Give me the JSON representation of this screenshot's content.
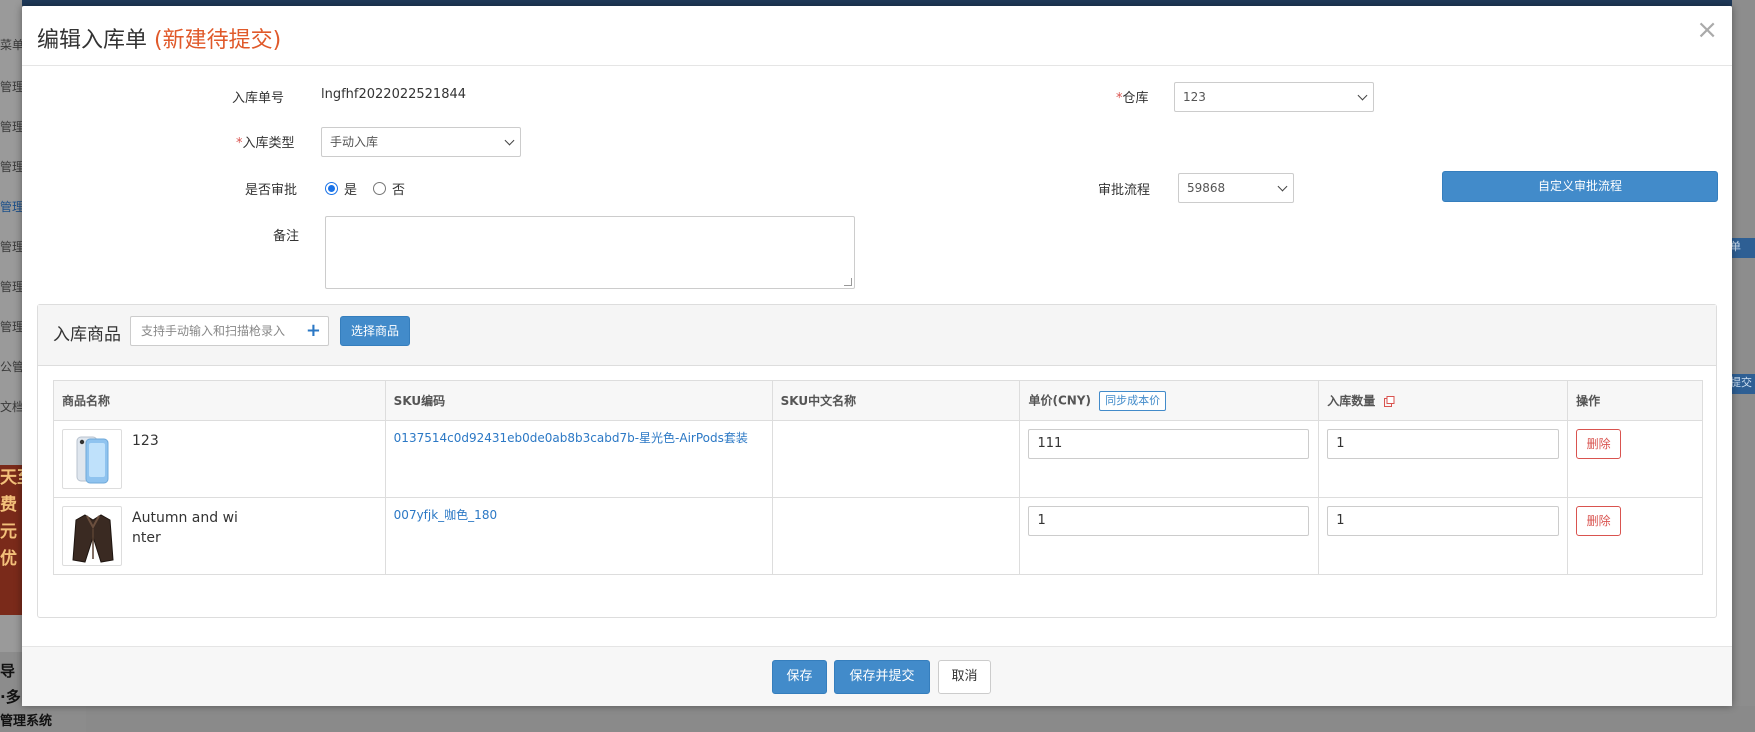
{
  "background": {
    "sidebar_items": [
      "菜单",
      "管理",
      "管理",
      "管理",
      "管理",
      "管理",
      "管理",
      "管理",
      "公管",
      "文档"
    ],
    "ad_lines": [
      "天至",
      "费",
      "元",
      "优"
    ],
    "bottom_left_lines": [
      "导",
      "·多",
      "管理系统"
    ],
    "right_tabs": [
      "单",
      "提交"
    ]
  },
  "modal": {
    "title": "编辑入库单",
    "status": "(新建待提交)",
    "close": "×"
  },
  "form": {
    "order_no_label": "入库单号",
    "order_no_value": "lngfhf2022022521844",
    "warehouse_label": "仓库",
    "warehouse_value": "123",
    "type_label": "入库类型",
    "type_value": "手动入库",
    "approval_label": "是否审批",
    "approval_yes": "是",
    "approval_no": "否",
    "approval_selected": "是",
    "flow_label": "审批流程",
    "flow_value": "59868",
    "custom_flow_button": "自定义审批流程",
    "remark_label": "备注",
    "remark_value": "",
    "required_mark": "*"
  },
  "goods": {
    "title": "入库商品",
    "scan_placeholder": "支持手动输入和扫描枪录入",
    "select_button": "选择商品",
    "columns": [
      "商品名称",
      "SKU编码",
      "SKU中文名称",
      "单价(CNY)",
      "入库数量",
      "操作"
    ],
    "sync_cost_button": "同步成本价",
    "rows": [
      {
        "name": "123",
        "sku": "0137514c0d92431eb0de0ab8b3cabd7b-星光色-AirPods套装",
        "sku_cn": "",
        "price": "111",
        "qty": "1",
        "delete": "删除",
        "thumb_icon": "phone-product-icon"
      },
      {
        "name": "Autumn and winter",
        "sku": "007yfjk_咖色_180",
        "sku_cn": "",
        "price": "1",
        "qty": "1",
        "delete": "删除",
        "thumb_icon": "jacket-product-icon"
      }
    ]
  },
  "footer": {
    "save": "保存",
    "save_submit": "保存并提交",
    "cancel": "取消"
  },
  "colors": {
    "primary": "#428bca",
    "danger": "#d9534f",
    "status": "#e0592a",
    "link": "#2b78c5"
  }
}
